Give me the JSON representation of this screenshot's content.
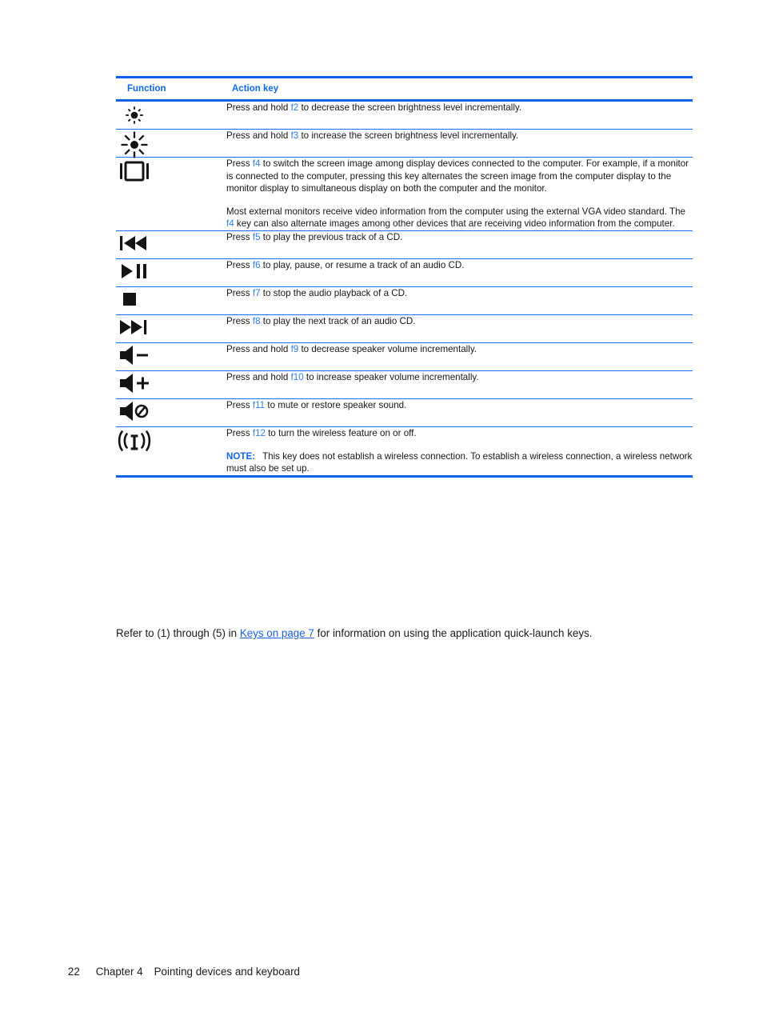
{
  "table": {
    "headers": {
      "function": "Function",
      "action_key": "Action key"
    },
    "accent_color": "#0f62e8",
    "rows": [
      {
        "icon": "brightness-down-icon",
        "paragraphs": [
          {
            "parts": [
              {
                "t": "Press and hold ",
                "s": "plain"
              },
              {
                "t": "f2",
                "s": "fkey"
              },
              {
                "t": " to decrease the screen brightness level incrementally.",
                "s": "plain"
              }
            ]
          }
        ]
      },
      {
        "icon": "brightness-up-icon",
        "paragraphs": [
          {
            "parts": [
              {
                "t": "Press and hold ",
                "s": "plain"
              },
              {
                "t": "f3",
                "s": "fkey"
              },
              {
                "t": " to increase the screen brightness level incrementally.",
                "s": "plain"
              }
            ]
          }
        ]
      },
      {
        "icon": "switch-display-icon",
        "paragraphs": [
          {
            "parts": [
              {
                "t": "Press ",
                "s": "plain"
              },
              {
                "t": "f4",
                "s": "fkey"
              },
              {
                "t": " to switch the screen image among display devices connected to the computer. For example, if a monitor is connected to the computer, pressing this key alternates the screen image from the computer display to the monitor display to simultaneous display on both the computer and the monitor.",
                "s": "plain"
              }
            ]
          },
          {
            "parts": [
              {
                "t": "Most external monitors receive video information from the computer using the external VGA video standard. The ",
                "s": "plain"
              },
              {
                "t": "f4",
                "s": "fkey"
              },
              {
                "t": " key can also alternate images among other devices that are receiving video information from the computer.",
                "s": "plain"
              }
            ]
          }
        ]
      },
      {
        "icon": "previous-track-icon",
        "paragraphs": [
          {
            "parts": [
              {
                "t": "Press ",
                "s": "plain"
              },
              {
                "t": "f5",
                "s": "fkey"
              },
              {
                "t": " to play the previous track of a CD.",
                "s": "plain"
              }
            ]
          }
        ]
      },
      {
        "icon": "play-pause-icon",
        "paragraphs": [
          {
            "parts": [
              {
                "t": "Press ",
                "s": "plain"
              },
              {
                "t": "f6",
                "s": "fkey"
              },
              {
                "t": " to play, pause, or resume a track of an audio CD.",
                "s": "plain"
              }
            ]
          }
        ]
      },
      {
        "icon": "stop-icon",
        "paragraphs": [
          {
            "parts": [
              {
                "t": "Press ",
                "s": "plain"
              },
              {
                "t": "f7",
                "s": "fkey"
              },
              {
                "t": " to stop the audio playback of a CD.",
                "s": "plain"
              }
            ]
          }
        ]
      },
      {
        "icon": "next-track-icon",
        "paragraphs": [
          {
            "parts": [
              {
                "t": "Press ",
                "s": "plain"
              },
              {
                "t": "f8",
                "s": "fkey"
              },
              {
                "t": " to play the next track of an audio CD.",
                "s": "plain"
              }
            ]
          }
        ]
      },
      {
        "icon": "volume-down-icon",
        "paragraphs": [
          {
            "parts": [
              {
                "t": "Press and hold ",
                "s": "plain"
              },
              {
                "t": "f9",
                "s": "fkey"
              },
              {
                "t": " to decrease speaker volume incrementally.",
                "s": "plain"
              }
            ]
          }
        ]
      },
      {
        "icon": "volume-up-icon",
        "paragraphs": [
          {
            "parts": [
              {
                "t": "Press and hold ",
                "s": "plain"
              },
              {
                "t": "f10",
                "s": "fkey"
              },
              {
                "t": " to increase speaker volume incrementally.",
                "s": "plain"
              }
            ]
          }
        ]
      },
      {
        "icon": "volume-mute-icon",
        "paragraphs": [
          {
            "parts": [
              {
                "t": "Press ",
                "s": "plain"
              },
              {
                "t": "f11",
                "s": "fkey"
              },
              {
                "t": " to mute or restore speaker sound.",
                "s": "plain"
              }
            ]
          }
        ]
      },
      {
        "icon": "wireless-icon",
        "paragraphs": [
          {
            "parts": [
              {
                "t": "Press ",
                "s": "plain"
              },
              {
                "t": "f12",
                "s": "fkey"
              },
              {
                "t": " to turn the wireless feature on or off.",
                "s": "plain"
              }
            ]
          },
          {
            "parts": [
              {
                "t": "NOTE:",
                "s": "note"
              },
              {
                "t": "GAP",
                "s": "gap"
              },
              {
                "t": "This key does not establish a wireless connection. To establish a wireless connection, a wireless network must also be set up.",
                "s": "plain"
              }
            ]
          }
        ]
      }
    ]
  },
  "refer_paragraph": {
    "before_link": "Refer to (1) through (5) in ",
    "link_text": "Keys on page 7",
    "after_link": " for information on using the application quick-launch keys."
  },
  "footer": {
    "page_number": "22",
    "chapter": "Chapter 4",
    "title": "Pointing devices and keyboard"
  }
}
